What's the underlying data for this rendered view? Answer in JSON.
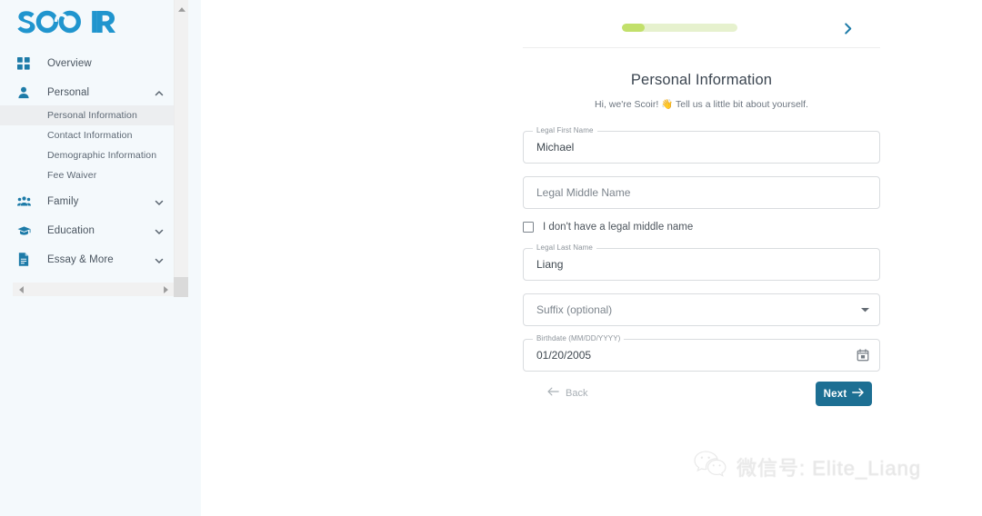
{
  "app": {
    "logo_text": "SCOIR",
    "logo_color": "#2095ce"
  },
  "sidebar": {
    "items": [
      {
        "label": "Overview",
        "icon": "grid-icon",
        "expandable": false
      },
      {
        "label": "Personal",
        "icon": "person-icon",
        "expandable": true,
        "expanded": true
      },
      {
        "label": "Family",
        "icon": "group-icon",
        "expandable": true,
        "expanded": false
      },
      {
        "label": "Education",
        "icon": "graduation-cap-icon",
        "expandable": true,
        "expanded": false
      },
      {
        "label": "Essay & More",
        "icon": "document-icon",
        "expandable": true,
        "expanded": false
      }
    ],
    "personal_subitems": [
      {
        "label": "Personal Information",
        "active": true
      },
      {
        "label": "Contact Information",
        "active": false
      },
      {
        "label": "Demographic Information",
        "active": false
      },
      {
        "label": "Fee Waiver",
        "active": false
      }
    ],
    "scrollbar": {
      "up_arrow": "▲",
      "down_arrow": "▼",
      "left_arrow": "◀",
      "right_arrow": "▶"
    }
  },
  "main": {
    "progress": {
      "percent": 20,
      "fill_color": "#c2e06b",
      "track_color": "#e6f1ce"
    },
    "next_chevron_icon": "chevron-right-icon",
    "title": "Personal Information",
    "subtitle_before": "Hi, we're Scoir!",
    "subtitle_emoji": "👋",
    "subtitle_after": "Tell us a little bit about yourself.",
    "fields": {
      "first_name": {
        "label": "Legal First Name",
        "value": "Michael"
      },
      "middle_name": {
        "label": "",
        "placeholder": "Legal Middle Name",
        "value": ""
      },
      "no_middle_name": {
        "label": "I don't have a legal middle name",
        "checked": false
      },
      "last_name": {
        "label": "Legal Last Name",
        "value": "Liang"
      },
      "suffix": {
        "label": "",
        "placeholder": "Suffix (optional)",
        "value": "",
        "icon": "dropdown-arrow-icon"
      },
      "birthdate": {
        "label": "Birthdate (MM/DD/YYYY)",
        "value": "01/20/2005",
        "icon": "calendar-icon"
      }
    },
    "actions": {
      "back_label": "Back",
      "back_icon": "arrow-left-icon",
      "next_label": "Next",
      "next_icon": "arrow-right-icon",
      "next_color": "#1d6f93"
    }
  },
  "watermark": {
    "icon": "wechat-icon",
    "text": "微信号: Elite_Liang"
  }
}
